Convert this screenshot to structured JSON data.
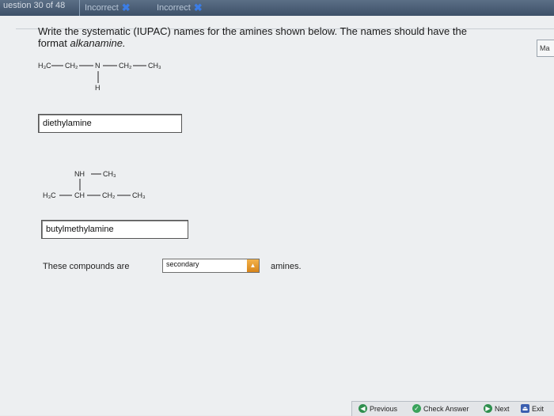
{
  "header": {
    "question_counter": "uestion 30 of 48",
    "tabs": [
      {
        "label": "Incorrect",
        "status": "incorrect"
      },
      {
        "label": "Incorrect",
        "status": "incorrect"
      }
    ],
    "side_label": "Ma"
  },
  "question": {
    "line1": "Write the systematic (IUPAC) names for the amines shown below. The names should have the",
    "line2_prefix": "format ",
    "line2_format": "alkanamine."
  },
  "structure1": {
    "left": "H₃C",
    "c2": "CH₂",
    "n": "N",
    "c3": "CH₂",
    "c4": "CH₃",
    "h": "H"
  },
  "answer1": "diethylamine",
  "structure2": {
    "nh": "NH",
    "me": "CH₃",
    "left": "H₃C",
    "ch": "CH",
    "c3": "CH₂",
    "c4": "CH₃"
  },
  "answer2": "butylmethylamine",
  "classification": {
    "prefix": "These compounds are",
    "selected": "secondary",
    "suffix": "amines."
  },
  "footer": {
    "previous": "Previous",
    "check_answer": "Check Answer",
    "next": "Next",
    "exit": "Exit"
  }
}
